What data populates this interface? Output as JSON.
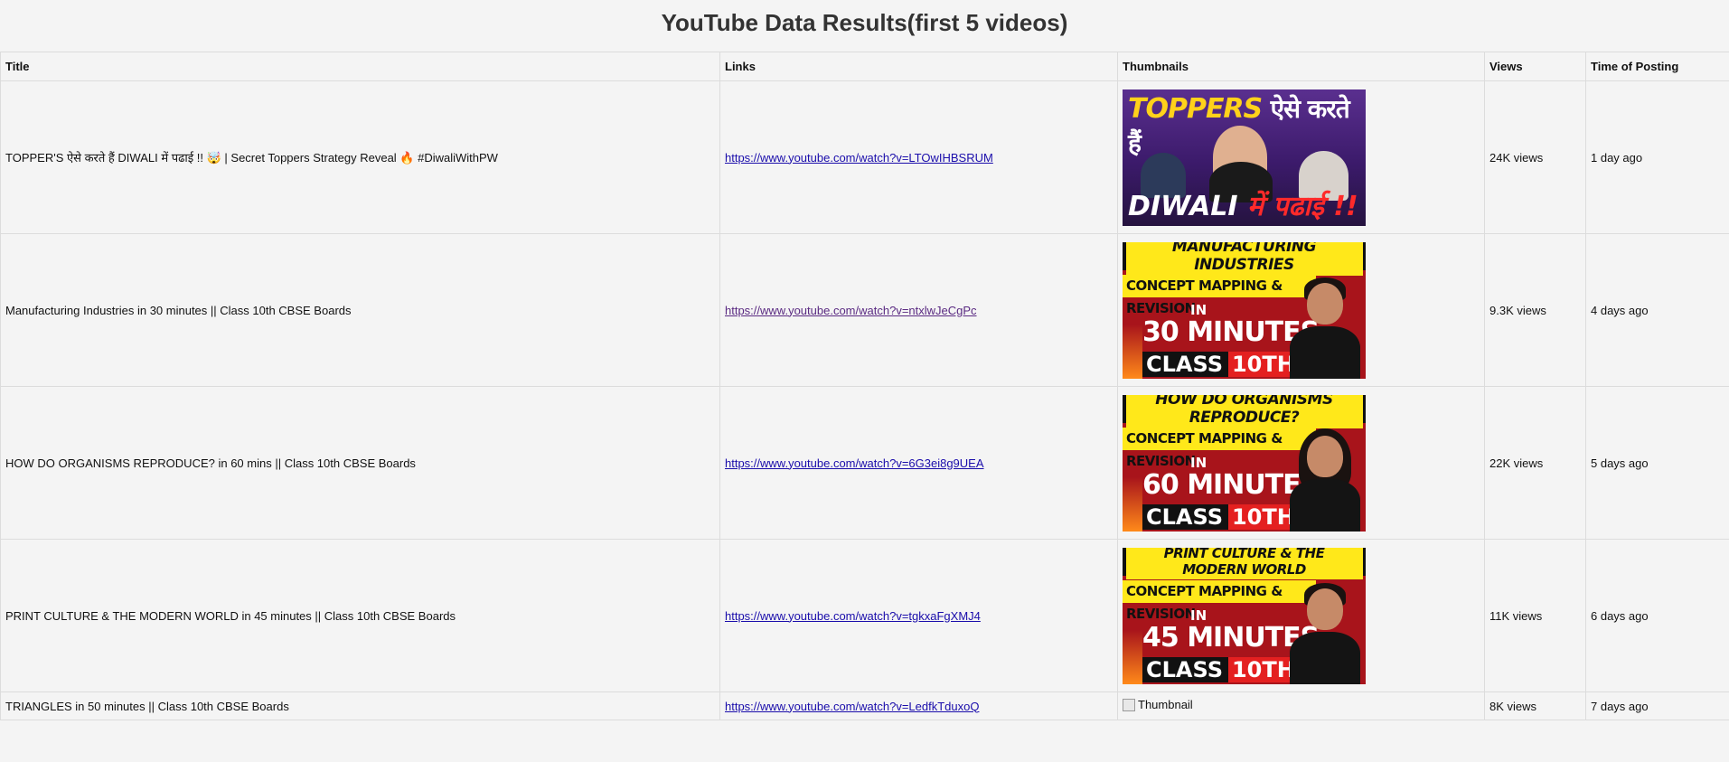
{
  "page": {
    "heading": "YouTube Data Results(first 5 videos)"
  },
  "table": {
    "headers": {
      "title": "Title",
      "links": "Links",
      "thumbnails": "Thumbnails",
      "views": "Views",
      "time": "Time of Posting"
    },
    "rows": [
      {
        "title": "TOPPER'S ऐसे करते हैं DIWALI में पढाई !! 🤯 | Secret Toppers Strategy Reveal 🔥 #DiwaliWithPW",
        "link": "https://www.youtube.com/watch?v=LTOwIHBSRUM",
        "views": "24K views",
        "time": "1 day ago",
        "thumb": {
          "top_en": "TOPPERS",
          "top_hi": "ऐसे करते हैं",
          "bottom_en": "DIWALI",
          "bottom_hi": "में पढाई !!"
        }
      },
      {
        "title": "Manufacturing Industries in 30 minutes || Class 10th CBSE Boards",
        "link": "https://www.youtube.com/watch?v=ntxlwJeCgPc",
        "views": "9.3K views",
        "time": "4 days ago",
        "thumb": {
          "banner": "MANUFACTURING INDUSTRIES",
          "sub": "CONCEPT MAPPING & REVISION",
          "in": "IN",
          "minutes": "30 MINUTES",
          "class": "CLASS",
          "class_num": "10TH"
        }
      },
      {
        "title": "HOW DO ORGANISMS REPRODUCE? in 60 mins || Class 10th CBSE Boards",
        "link": "https://www.youtube.com/watch?v=6G3ei8g9UEA",
        "views": "22K views",
        "time": "5 days ago",
        "thumb": {
          "banner": "HOW DO ORGANISMS REPRODUCE?",
          "sub": "CONCEPT MAPPING & REVISION",
          "in": "IN",
          "minutes": "60 MINUTES",
          "class": "CLASS",
          "class_num": "10TH"
        }
      },
      {
        "title": "PRINT CULTURE & THE MODERN WORLD in 45 minutes || Class 10th CBSE Boards",
        "link": "https://www.youtube.com/watch?v=tgkxaFgXMJ4",
        "views": "11K views",
        "time": "6 days ago",
        "thumb": {
          "banner": "PRINT CULTURE & THE MODERN WORLD",
          "sub": "CONCEPT MAPPING & REVISION",
          "in": "IN",
          "minutes": "45 MINUTES",
          "class": "CLASS",
          "class_num": "10TH"
        }
      },
      {
        "title": "TRIANGLES in 50 minutes || Class 10th CBSE Boards",
        "link": "https://www.youtube.com/watch?v=LedfkTduxoQ",
        "views": "8K views",
        "time": "7 days ago",
        "thumb_alt": "Thumbnail"
      }
    ]
  },
  "colors": {
    "link": "#1a0dab",
    "visited_link": "#5a2a82",
    "page_bg": "#f4f4f4"
  }
}
